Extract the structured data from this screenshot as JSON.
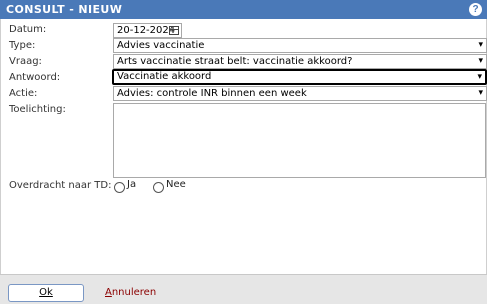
{
  "window": {
    "title": "CONSULT - NIEUW",
    "help_icon": "?"
  },
  "form": {
    "datum": {
      "label": "Datum:",
      "value": "20-12-2024"
    },
    "type": {
      "label": "Type:",
      "value": "Advies vaccinatie"
    },
    "vraag": {
      "label": "Vraag:",
      "value": "Arts vaccinatie straat belt: vaccinatie akkoord?"
    },
    "antwoord": {
      "label": "Antwoord:",
      "value": "Vaccinatie akkoord"
    },
    "actie": {
      "label": "Actie:",
      "value": "Advies: controle INR binnen een week"
    },
    "toelichting": {
      "label": "Toelichting:",
      "value": ""
    },
    "overdracht": {
      "label": "Overdracht naar TD:",
      "options": [
        "Ja",
        "Nee"
      ],
      "selected": null
    }
  },
  "footer": {
    "ok_label": "Ok",
    "cancel_label_first": "A",
    "cancel_label_rest": "nnuleren"
  },
  "icons": {
    "calendar": "calendar-icon",
    "chevron": "chevron-down-icon",
    "help": "help-icon"
  },
  "colors": {
    "titlebar": "#4a79b8",
    "cancel": "#8b0000"
  }
}
